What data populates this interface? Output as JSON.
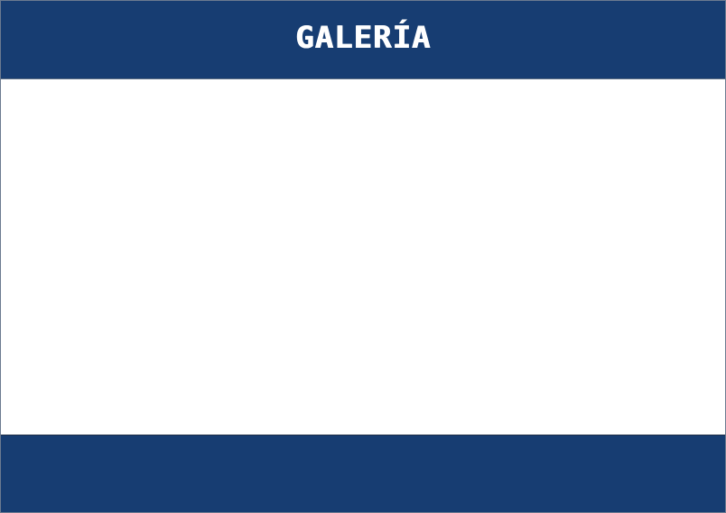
{
  "header": {
    "title": "GALERÍA"
  },
  "colors": {
    "header_bg": "#173d72",
    "footer_bg": "#173d72",
    "title": "#ffffff",
    "content_bg": "#ffffff"
  }
}
